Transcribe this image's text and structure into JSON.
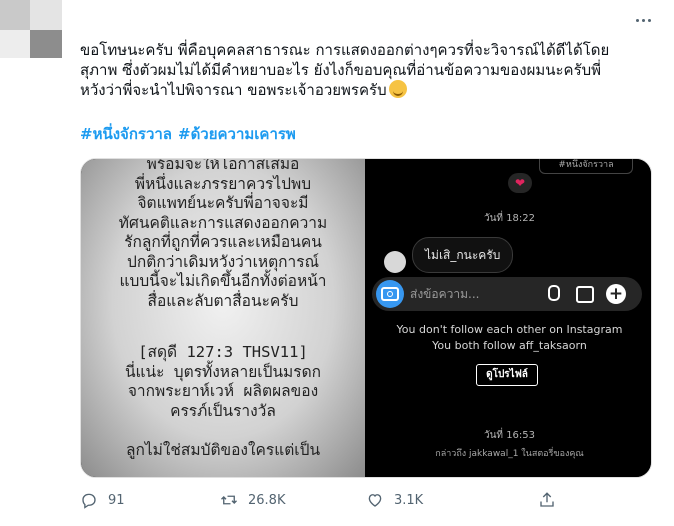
{
  "tweet": {
    "text_lines": [
      "ขอโทษนะครับ พี่คือบุคคลสาธารณะ การแสดงออกต่างๆควรที่จะวิจารณ์ได้ดีได้โดย",
      "สุภาพ ซึ่งตัวผมไม่ได้มีคำหยาบอะไร ยังไงก็ขอบคุณที่อ่านข้อความของผมนะครับพี่",
      "หวังว่าพี่จะนำไปพิจารณา ขอพระเจ้าอวยพรครับ"
    ],
    "emoji": "smiling-face-with-smiling-eyes",
    "hashtags": [
      "#หนึ่งจักรวาล",
      "#ด้วยความเคารพ"
    ]
  },
  "image_left": {
    "lines_a": [
      "พร้อมจะให้โอกาสเสมอ",
      "พี่หนึ่งและภรรยาควรไปพบ",
      "จิตแพทย์นะครับพี่อาจจะมี",
      "ทัศนคติและการแสดงออกความ",
      "รักลูกที่ถูกที่ควรและเหมือนคน",
      "ปกติกว่าเดิมหวังว่าเหตุการณ์",
      "แบบนี้จะไม่เกิดขึ้นอีกทั้งต่อหน้า",
      "สื่อและลับตาสื่อนะครับ"
    ],
    "lines_b": [
      "[สดุดี 127:3 THSV11]",
      "นี่แน่ะ บุตรทั้งหลายเป็นมรดก",
      "จากพระยาห์เวห์ ผลิตผลของ",
      "ครรภ์เป็นรางวัล"
    ],
    "lines_c": [
      "ลูกไม่ใช่สมบัติของใครแต่เป็น"
    ]
  },
  "image_right_top": {
    "tag": "#หนึ่งจักรวาล",
    "heart": "❤",
    "time": "วันที่ 18:22",
    "message": "ไม่เสิ_กนะครับ",
    "composer_placeholder": "ส่งข้อความ..."
  },
  "image_right_bottom": {
    "line1": "You don't follow each other on Instagram",
    "line2": "You both follow aff_taksaorn",
    "button": "ดูโปรไฟล์",
    "time": "วันที่ 16:53",
    "mention": "กล่าวถึง jakkawal_1 ในสตอรี่ของคุณ"
  },
  "actions": {
    "reply_count": "91",
    "retweet_count": "26.8K",
    "like_count": "3.1K"
  },
  "colors": {
    "accent": "#1d9bf0",
    "muted": "#536471",
    "instagram_blue": "#3797f0"
  }
}
